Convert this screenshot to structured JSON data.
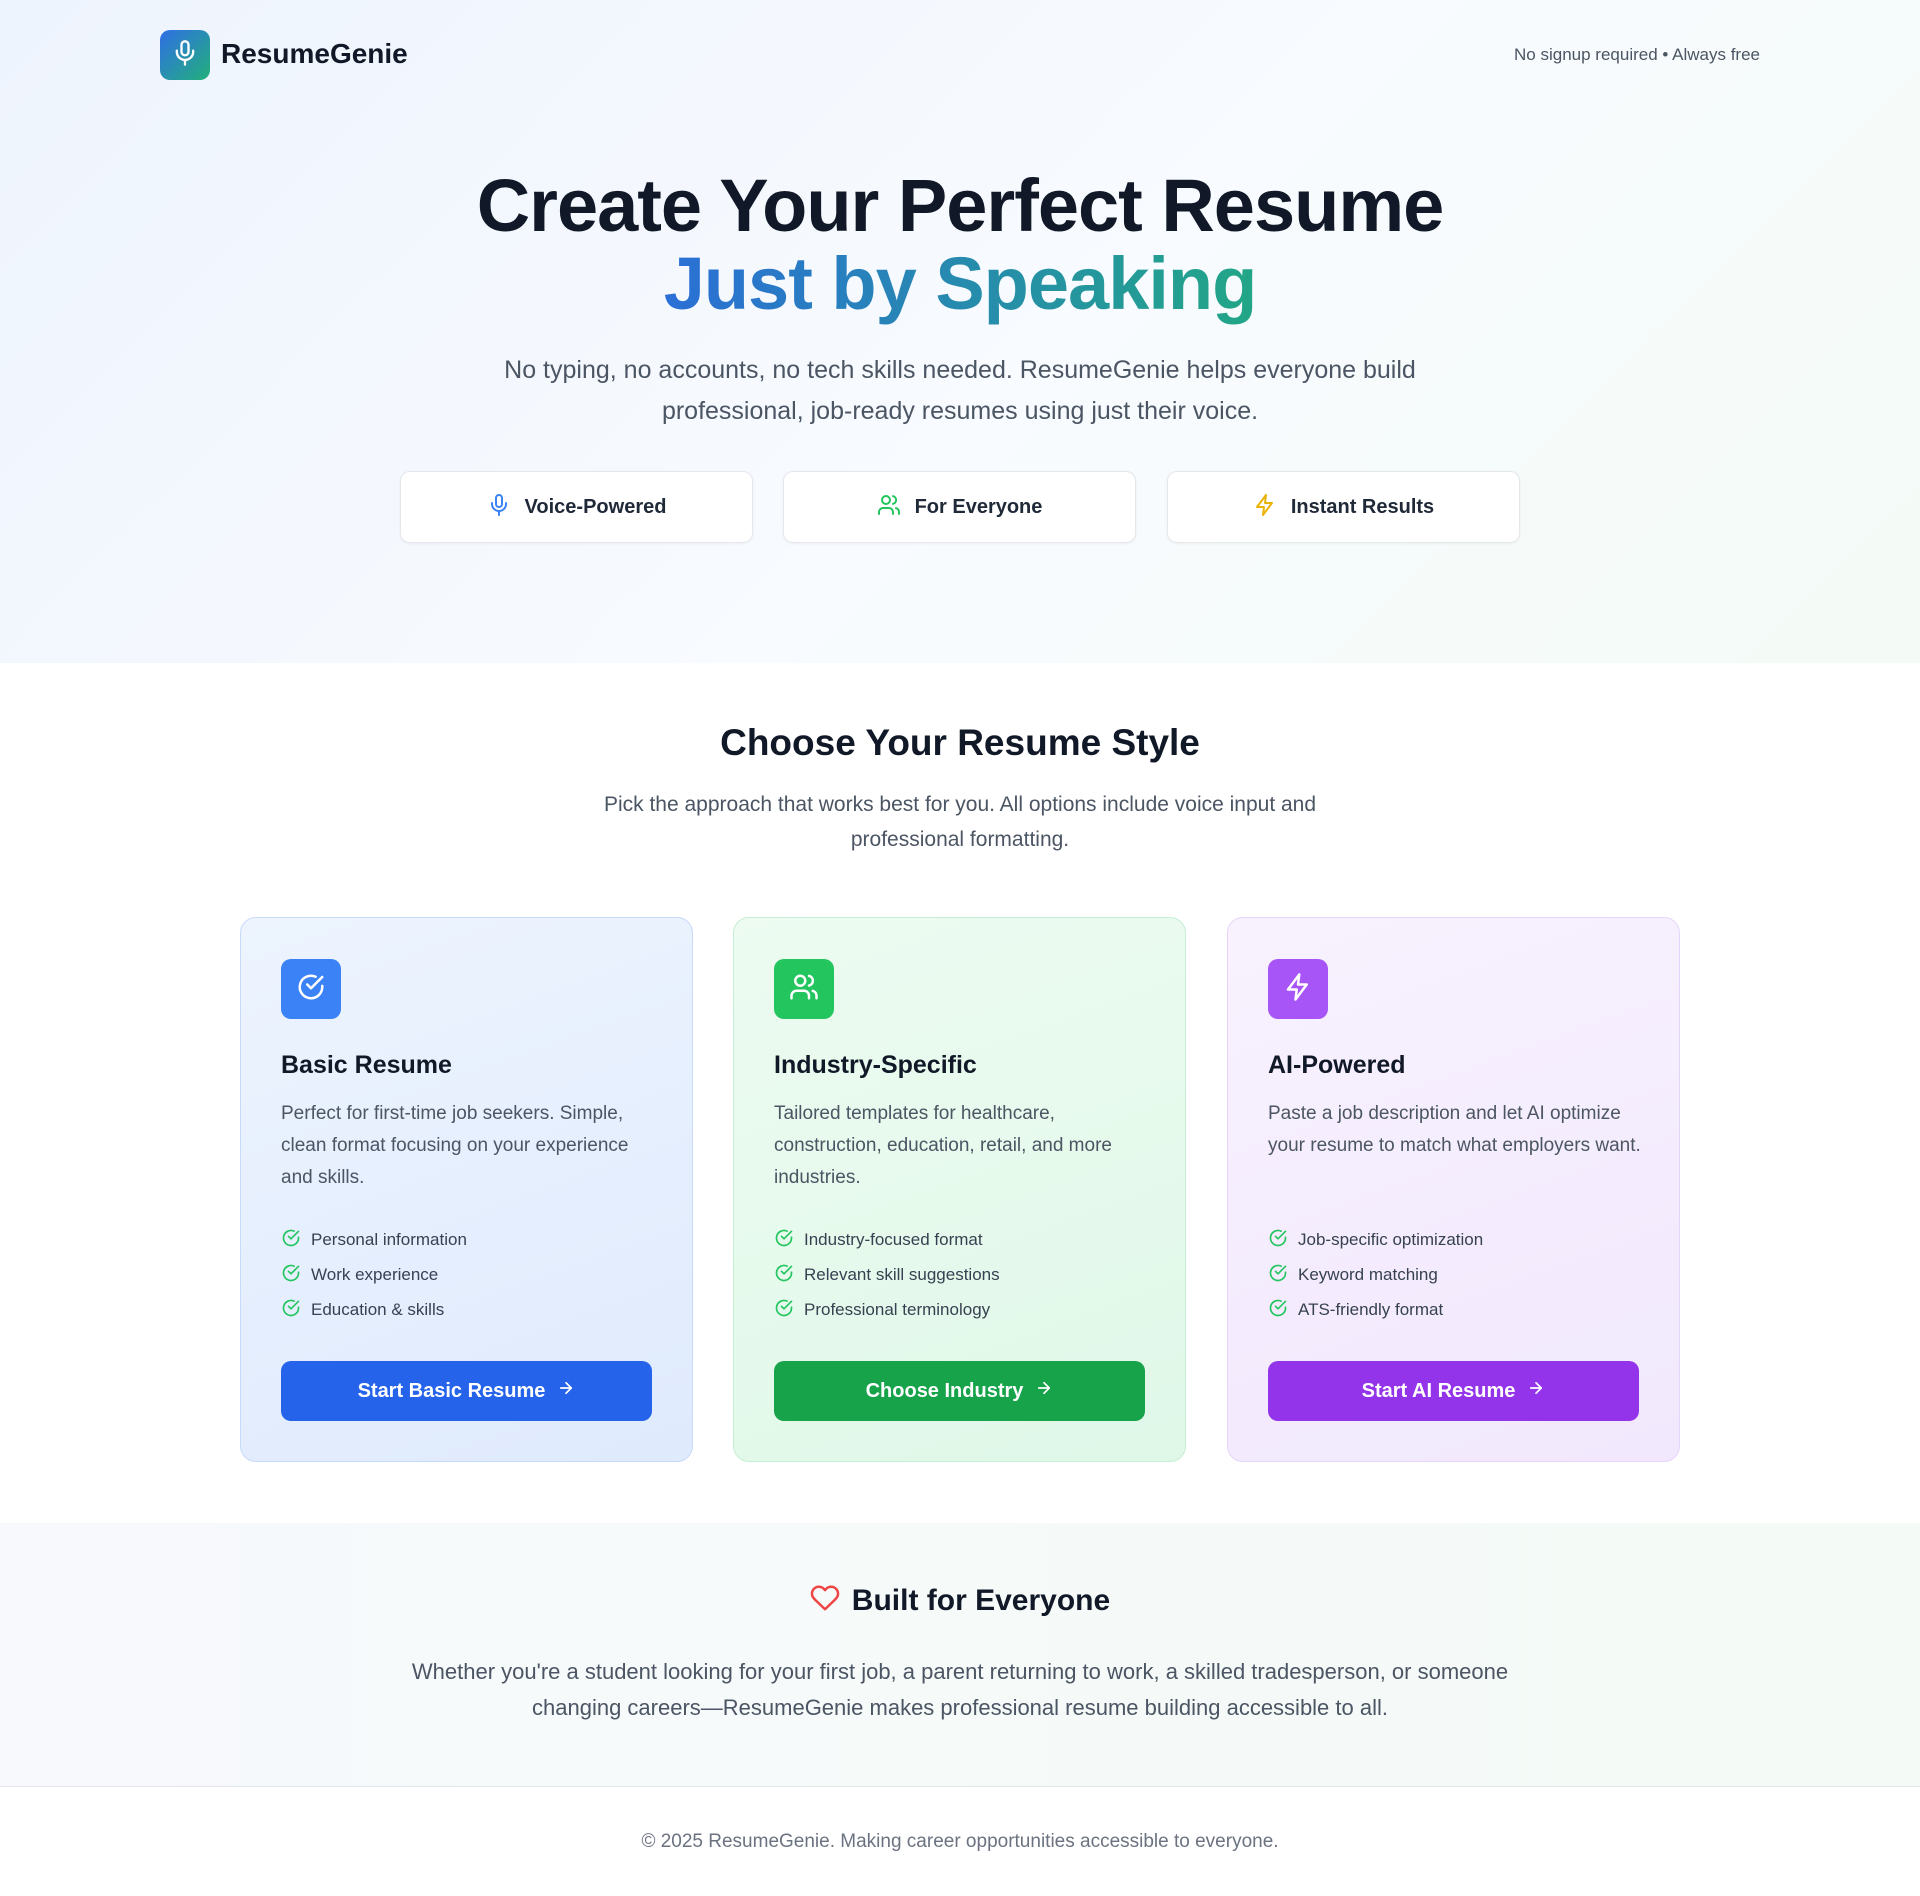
{
  "header": {
    "app_name": "ResumeGenie",
    "tagline": "No signup required • Always free",
    "logo_icon": "microphone-icon"
  },
  "hero": {
    "title_line1": "Create Your Perfect Resume",
    "title_line2": "Just by Speaking",
    "subtitle": "No typing, no accounts, no tech skills needed. ResumeGenie helps everyone build professional, job-ready resumes using just their voice.",
    "pills": [
      {
        "label": "Voice-Powered",
        "icon": "microphone-icon",
        "color": "#3b82f6"
      },
      {
        "label": "For Everyone",
        "icon": "users-icon",
        "color": "#22c55e"
      },
      {
        "label": "Instant Results",
        "icon": "lightning-icon",
        "color": "#eab308"
      }
    ]
  },
  "styles_section": {
    "title": "Choose Your Resume Style",
    "subtitle": "Pick the approach that works best for you. All options include voice input and professional formatting.",
    "cards": [
      {
        "title": "Basic Resume",
        "icon": "check-circle-icon",
        "accent": "#3b82f6",
        "description": "Perfect for first-time job seekers. Simple, clean format focusing on your experience and skills.",
        "features": [
          "Personal information",
          "Work experience",
          "Education & skills"
        ],
        "button_label": "Start Basic Resume",
        "button_color": "#2563eb"
      },
      {
        "title": "Industry-Specific",
        "icon": "users-icon",
        "accent": "#22c55e",
        "description": "Tailored templates for healthcare, construction, education, retail, and more industries.",
        "features": [
          "Industry-focused format",
          "Relevant skill suggestions",
          "Professional terminology"
        ],
        "button_label": "Choose Industry",
        "button_color": "#16a34a"
      },
      {
        "title": "AI-Powered",
        "icon": "lightning-icon",
        "accent": "#a855f7",
        "description": "Paste a job description and let AI optimize your resume to match what employers want.",
        "features": [
          "Job-specific optimization",
          "Keyword matching",
          "ATS-friendly format"
        ],
        "button_label": "Start AI Resume",
        "button_color": "#9333ea"
      }
    ]
  },
  "everyone": {
    "title": "Built for Everyone",
    "icon": "heart-icon",
    "text": "Whether you're a student looking for your first job, a parent returning to work, a skilled tradesperson, or someone changing careers—ResumeGenie makes professional resume building accessible to all."
  },
  "footer": {
    "text": "© 2025 ResumeGenie. Making career opportunities accessible to everyone."
  }
}
